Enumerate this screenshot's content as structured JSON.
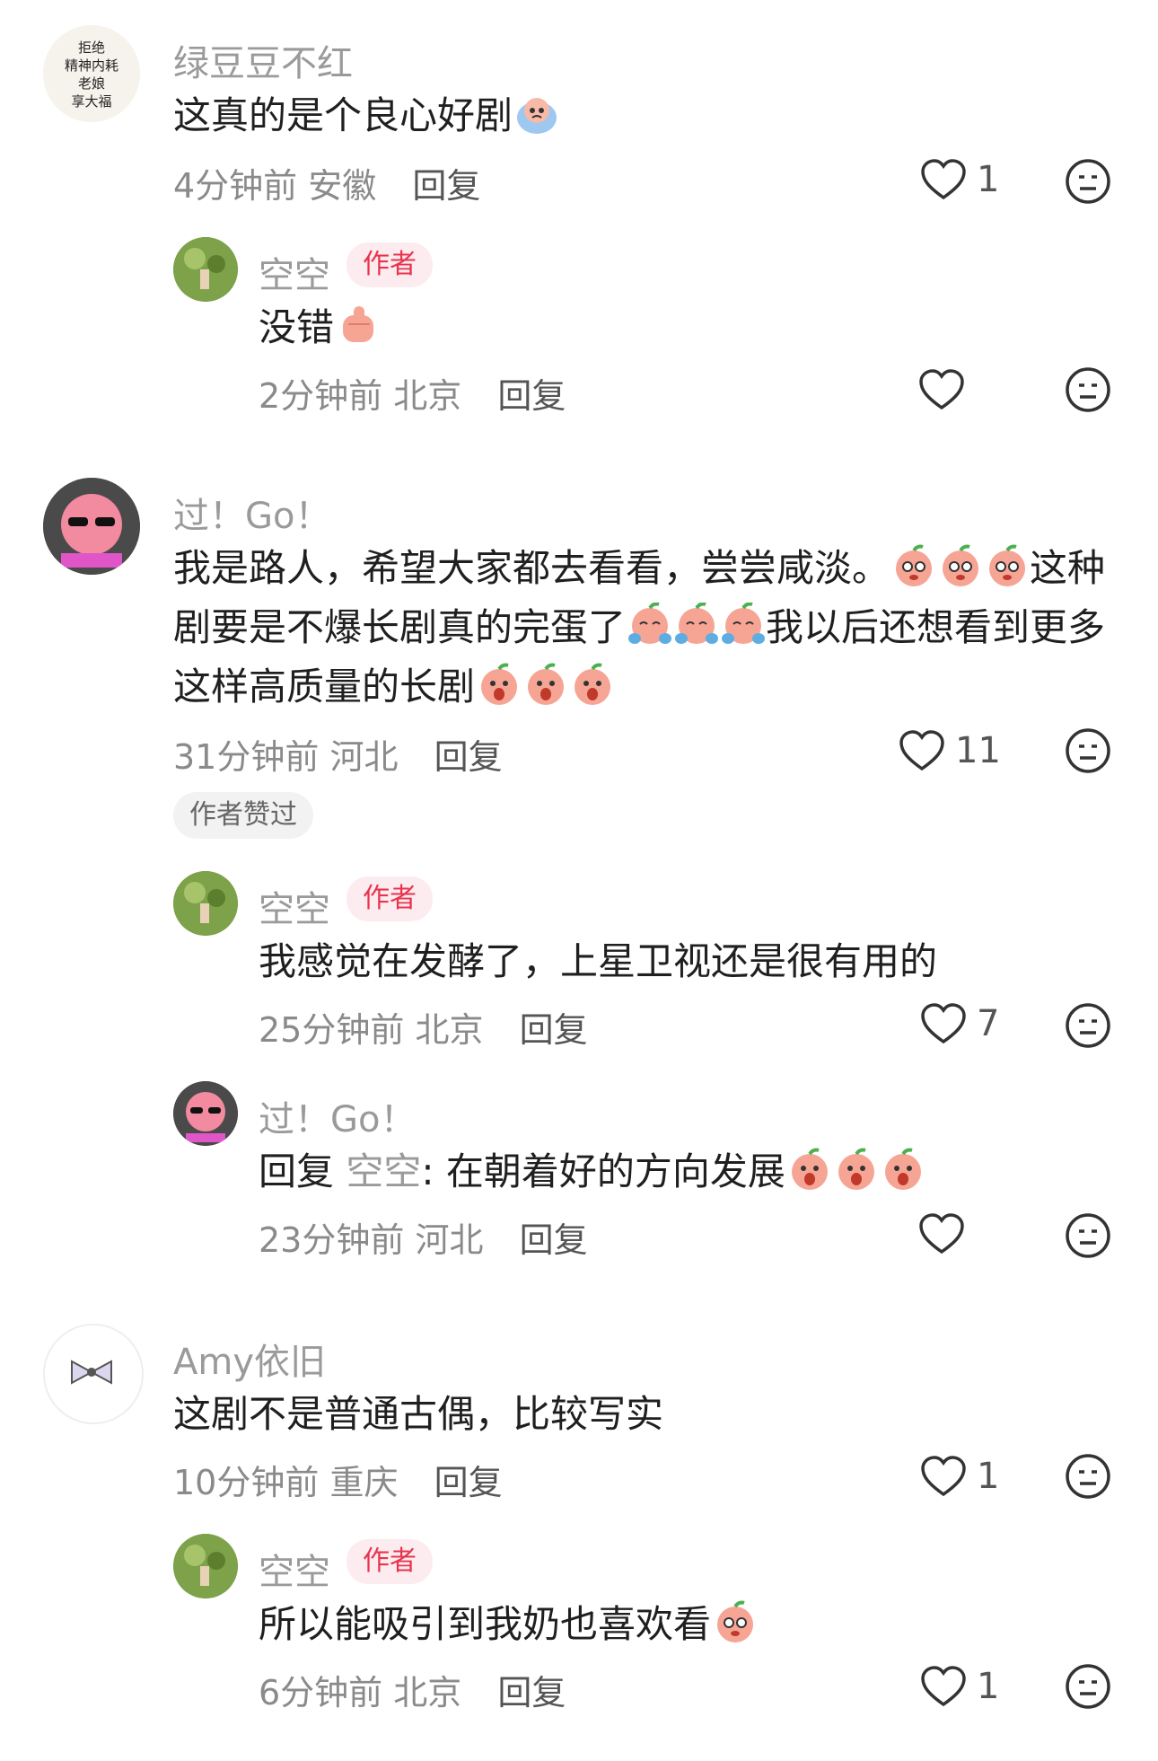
{
  "comments": [
    {
      "username": "绿豆豆不红",
      "text": "这真的是个良心好剧",
      "time": "4分钟前",
      "location": "安徽",
      "reply_label": "回复",
      "likes": "1",
      "avatar_text": "拒绝精神内耗老娘享大福"
    },
    {
      "username": "空空",
      "author_badge": "作者",
      "text": "没错",
      "time": "2分钟前",
      "location": "北京",
      "reply_label": "回复",
      "likes": ""
    },
    {
      "username": "过！Go！",
      "text_parts": [
        "我是路人，希望大家都去看看，尝尝咸淡。",
        "这种",
        "剧要是不爆长剧真的完蛋了",
        "我以后还想看到更多",
        "这样高质量的长剧"
      ],
      "time": "31分钟前",
      "location": "河北",
      "reply_label": "回复",
      "likes": "11",
      "liked_by_author": "作者赞过"
    },
    {
      "username": "空空",
      "author_badge": "作者",
      "text": "我感觉在发酵了，上星卫视还是很有用的",
      "time": "25分钟前",
      "location": "北京",
      "reply_label": "回复",
      "likes": "7"
    },
    {
      "username": "过！Go！",
      "reply_prefix": "回复",
      "mention": "空空",
      "text": ": 在朝着好的方向发展",
      "time": "23分钟前",
      "location": "河北",
      "reply_label": "回复",
      "likes": ""
    },
    {
      "username": "Amy依旧",
      "text": "这剧不是普通古偶，比较写实",
      "time": "10分钟前",
      "location": "重庆",
      "reply_label": "回复",
      "likes": "1"
    },
    {
      "username": "空空",
      "author_badge": "作者",
      "text": "所以能吸引到我奶也喜欢看",
      "time": "6分钟前",
      "location": "北京",
      "reply_label": "回复",
      "likes": "1"
    }
  ],
  "colors": {
    "author_badge_bg": "#fdecef",
    "author_badge_text": "#e8344e",
    "meta_text": "#8a8a8a"
  },
  "icons": [
    "heart-icon",
    "dislike-face-icon",
    "emoji-peach-icon"
  ]
}
